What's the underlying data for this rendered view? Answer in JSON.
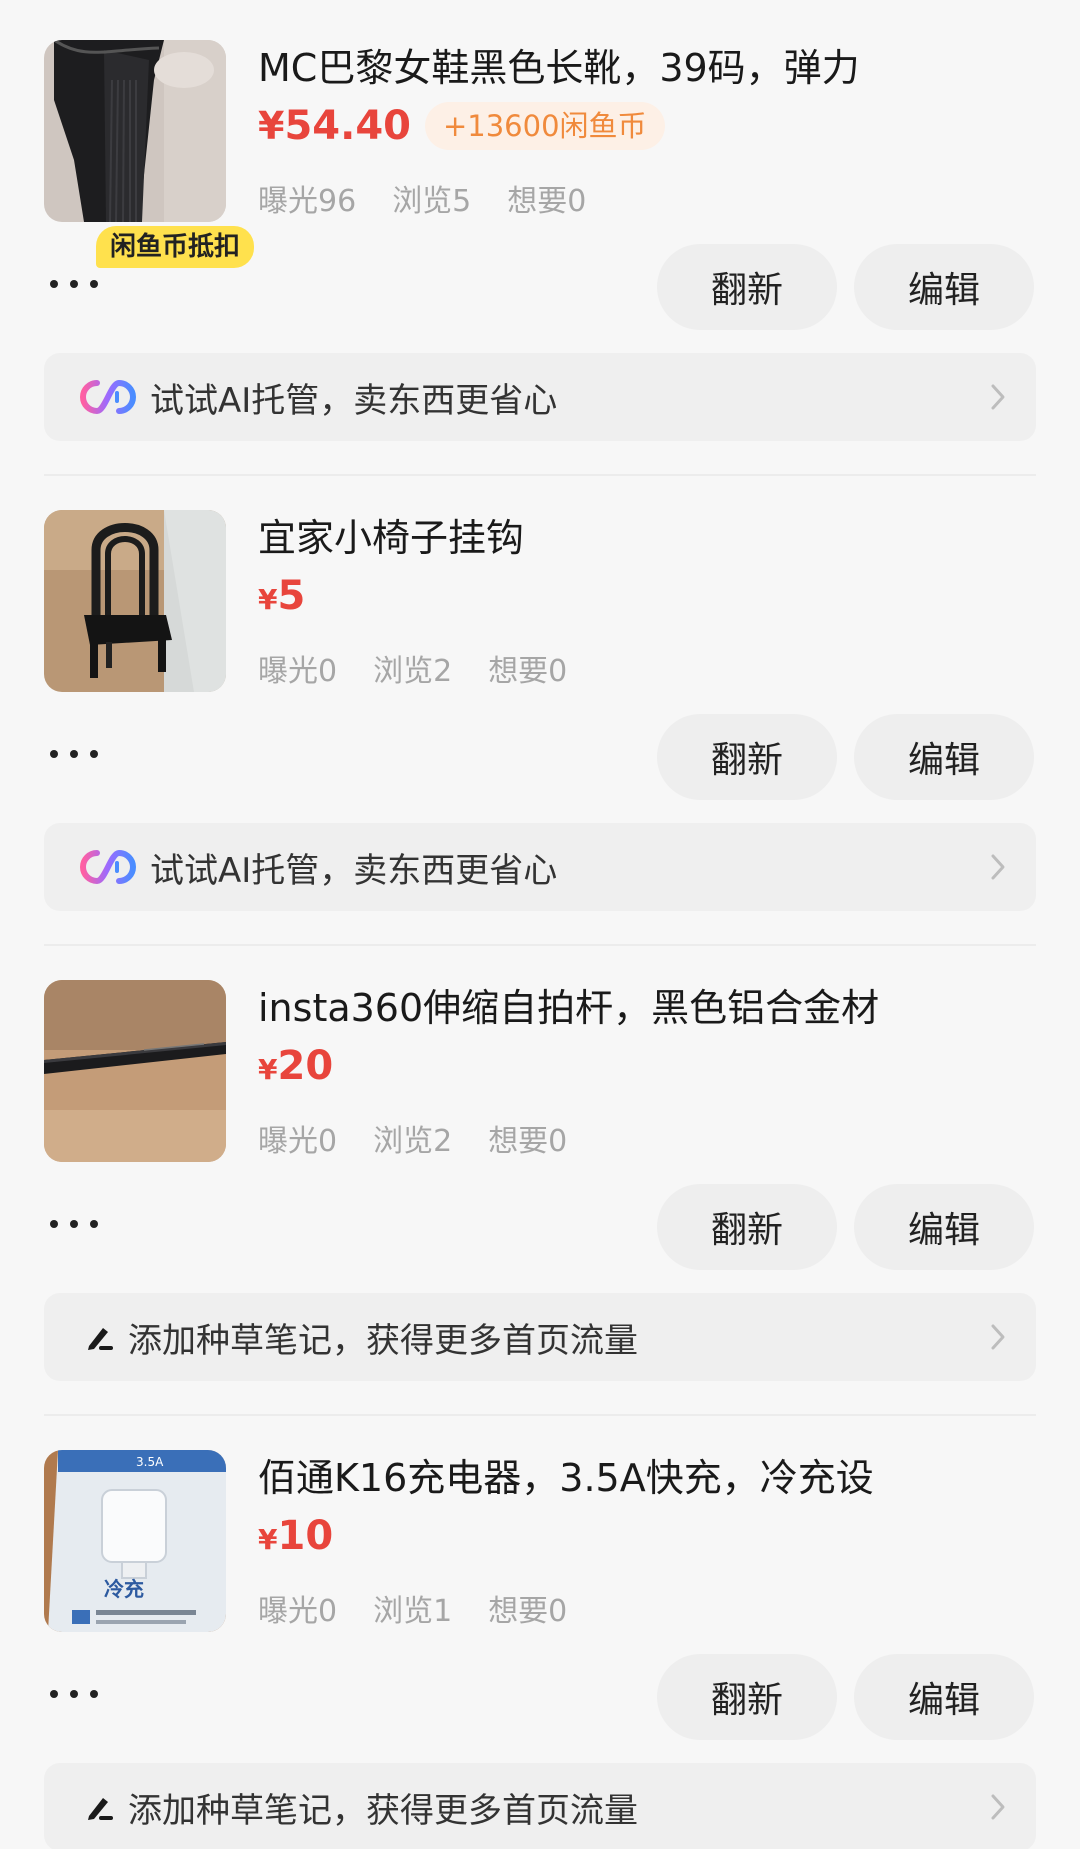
{
  "items": [
    {
      "title": "MC巴黎女鞋黑色长靴，39码，弹力",
      "price_symbol": "¥",
      "price_value": "54.40",
      "coin_pill": "+13600闲鱼币",
      "coin_tag": "闲鱼币抵扣",
      "stats": {
        "exposure": "曝光96",
        "views": "浏览5",
        "wants": "想要0"
      },
      "refresh_label": "翻新",
      "edit_label": "编辑",
      "banner": {
        "icon": "ai-agent-icon",
        "text": "试试AI托管，卖东西更省心"
      },
      "thumb_icon": "black-boot-photo"
    },
    {
      "title": "宜家小椅子挂钩",
      "price_symbol": "¥",
      "price_value": "5",
      "stats": {
        "exposure": "曝光0",
        "views": "浏览2",
        "wants": "想要0"
      },
      "refresh_label": "翻新",
      "edit_label": "编辑",
      "banner": {
        "icon": "ai-agent-icon",
        "text": "试试AI托管，卖东西更省心"
      },
      "thumb_icon": "chair-hook-photo"
    },
    {
      "title": "insta360伸缩自拍杆，黑色铝合金材",
      "price_symbol": "¥",
      "price_value": "20",
      "stats": {
        "exposure": "曝光0",
        "views": "浏览2",
        "wants": "想要0"
      },
      "refresh_label": "翻新",
      "edit_label": "编辑",
      "banner": {
        "icon": "pen-icon",
        "text": "添加种草笔记，获得更多首页流量"
      },
      "thumb_icon": "selfie-stick-photo"
    },
    {
      "title": "佰通K16充电器，3.5A快充，冷充设",
      "price_symbol": "¥",
      "price_value": "10",
      "stats": {
        "exposure": "曝光0",
        "views": "浏览1",
        "wants": "想要0"
      },
      "refresh_label": "翻新",
      "edit_label": "编辑",
      "banner": {
        "icon": "pen-icon",
        "text": "添加种草笔记，获得更多首页流量"
      },
      "thumb_icon": "charger-box-photo"
    }
  ],
  "colors": {
    "price": "#e8453c",
    "coin_pill_text": "#f08a3c",
    "coin_tag_bg": "#ffe14d",
    "stats": "#a6a6a6"
  },
  "charger_box_text": {
    "top_label": "3.5A",
    "brand": "冷充"
  }
}
